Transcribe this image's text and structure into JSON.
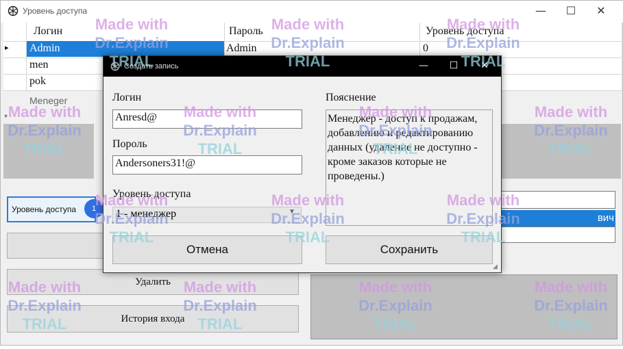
{
  "window": {
    "title": "Уровень доступа",
    "min_glyph": "—",
    "max_glyph": "☐",
    "close_glyph": "✕"
  },
  "grid": {
    "columns": [
      "Логин",
      "Пароль",
      "Уровень доступа"
    ],
    "rows": [
      {
        "login": "Admin",
        "password": "Admin",
        "level": "0"
      },
      {
        "login": "men",
        "password": "",
        "level": ""
      },
      {
        "login": "pok",
        "password": "",
        "level": ""
      },
      {
        "login": "Meneger",
        "password": "",
        "level": ""
      }
    ],
    "row_indicator": "▸",
    "new_row_indicator": "*"
  },
  "filter": {
    "label": "Уровень доступа",
    "badge": "1"
  },
  "actions": {
    "delete_label": "Удалить",
    "history_label": "История входа"
  },
  "side_list": {
    "selected_fragment": "вич"
  },
  "dialog": {
    "title": "Создать запись",
    "min_glyph": "—",
    "max_glyph": "☐",
    "close_glyph": "✕",
    "login_label": "Логин",
    "login_value": "Anresd@",
    "password_label": "Пороль",
    "password_value": "Andersoners31!@",
    "level_label": "Уровень доступа",
    "level_value": "1 - менеджер",
    "explanation_label": "Пояснение",
    "explanation_text": "Менеджер - доступ к продажам, добавлению и редактированию данных (удаление не доступно - кроме заказов которые не проведены.)",
    "cancel_label": "Отмена",
    "save_label": "Сохранить"
  },
  "watermark": {
    "line1": "Made with",
    "line2": "Dr.Explain",
    "line3": "TRIAL"
  },
  "colors": {
    "selection": "#1e7fd8",
    "badge": "#2f6fe0",
    "dialog_titlebar": "#000000"
  }
}
